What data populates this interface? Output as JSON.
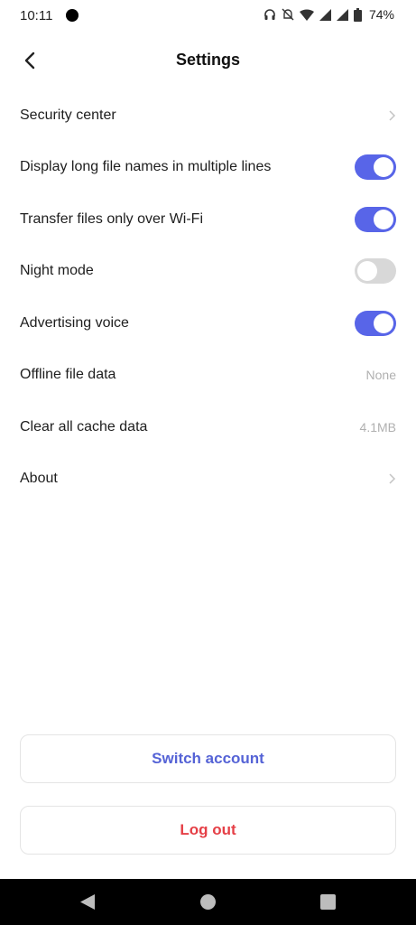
{
  "status_bar": {
    "time": "10:11",
    "battery": "74%",
    "icons": [
      "headphones-icon",
      "mute-icon",
      "wifi-icon",
      "signal-icon",
      "signal-icon",
      "battery-icon"
    ]
  },
  "header": {
    "title": "Settings",
    "back_icon": "chevron-left-icon"
  },
  "settings": {
    "items": [
      {
        "label": "Security center",
        "kind": "link"
      },
      {
        "label": "Display long file names in multiple lines",
        "kind": "toggle",
        "on": true
      },
      {
        "label": "Transfer files only over Wi-Fi",
        "kind": "toggle",
        "on": true
      },
      {
        "label": "Night mode",
        "kind": "toggle",
        "on": false
      },
      {
        "label": "Advertising voice",
        "kind": "toggle",
        "on": true
      },
      {
        "label": "Offline file data",
        "kind": "value",
        "value": "None"
      },
      {
        "label": "Clear all cache data",
        "kind": "value",
        "value": "4.1MB"
      },
      {
        "label": "About",
        "kind": "link"
      }
    ]
  },
  "actions": {
    "switch_account": "Switch account",
    "log_out": "Log out"
  },
  "colors": {
    "accent": "#5865e8",
    "toggle_off": "#d8d8d8",
    "danger": "#e53f46",
    "switch_text": "#5563d6"
  }
}
